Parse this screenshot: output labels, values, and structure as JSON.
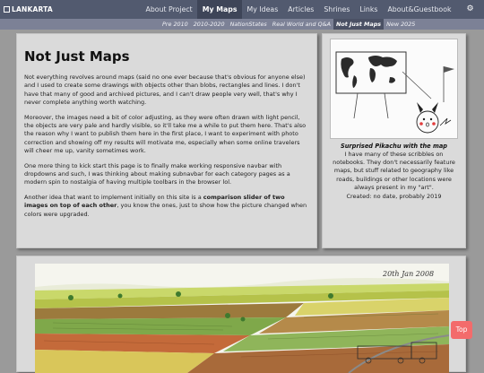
{
  "brand": {
    "name": "LANKARTA"
  },
  "nav": {
    "items": [
      "About Project",
      "My Maps",
      "My Ideas",
      "Articles",
      "Shrines",
      "Links",
      "About&Guestbook"
    ],
    "active": "My Maps"
  },
  "subnav": {
    "items": [
      "Pre 2010",
      "2010-2020",
      "NationStates",
      "Real World and Q&A",
      "Not Just Maps",
      "New 2025"
    ],
    "highlighted_unreadable": "",
    "active": "Not Just Maps"
  },
  "main": {
    "title": "Not Just Maps",
    "paragraphs": [
      "Not everything revolves around maps (said no one ever because that's obvious for anyone else) and I used to create some drawings with objects other than blobs, rectangles and lines. I don't have that many of good and archived pictures, and I can't draw people very well, that's why I never complete anything worth watching.",
      "Moreover, the images need a bit of color adjusting, as they were often drawn with light pencil, the objects are very pale and hardly visible, so it'll take me a while to put them here. That's also the reason why I want to publish them here in the first place, I want to experiment with photo correction and showing off my results will motivate me, especially when some online travelers will cheer me up, vanity sometimes work.",
      "One more thing to kick start this page is to finally make working responsive navbar with dropdowns and such, I was thinking about making subnavbar for each category pages as a modern spin to nostalgia of having multiple toolbars in the browser lol."
    ],
    "last_para": {
      "prefix": "Another idea that want to implement initially on this site is a ",
      "bold": "comparison slider of two images on top of each other",
      "suffix": ", you know the ones, just to show how the picture changed when colors were upgraded."
    }
  },
  "side": {
    "caption_title": "Surprised Pikachu with the map",
    "caption_lines": [
      "I have many of these scribbles on notebooks. They don't necessarily feature maps, but stuff related to geography like roads, buildings or other locations were always present in my \"art\".",
      "Created: no date, probably 2019"
    ]
  },
  "bottom": {
    "handwritten_date": "20th Jan 2008"
  },
  "ui": {
    "top_button": "Top",
    "settings_icon": "gear-icon"
  }
}
